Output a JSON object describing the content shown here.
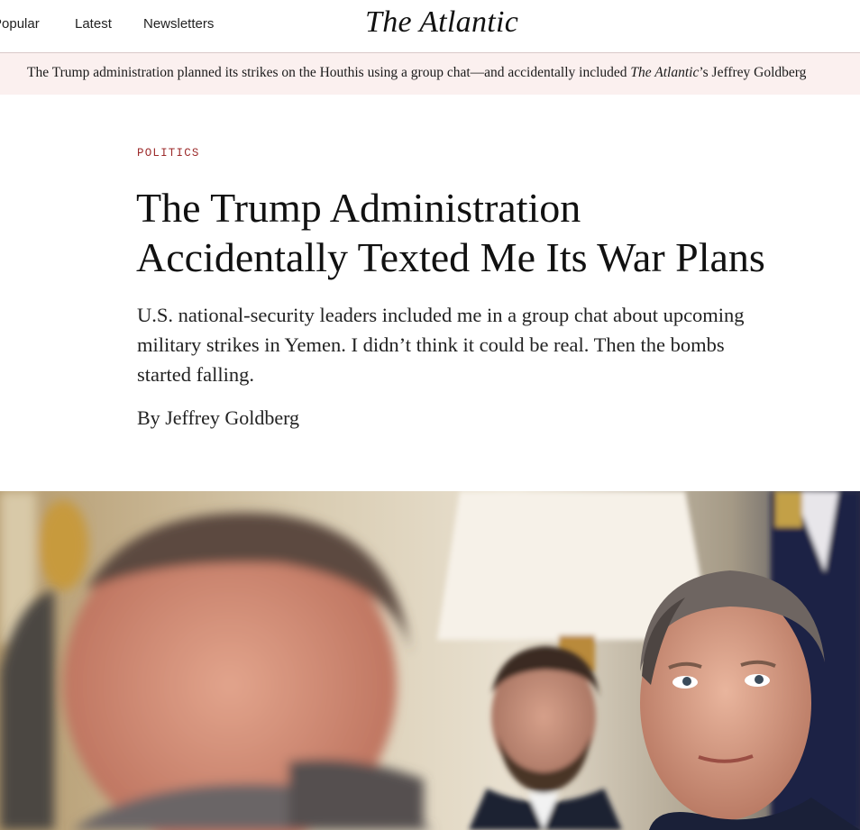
{
  "nav": {
    "items": [
      {
        "label": "Popular"
      },
      {
        "label": "Latest"
      },
      {
        "label": "Newsletters"
      }
    ],
    "logo": "The Atlantic"
  },
  "ticker": {
    "text_before": "The Trump administration planned its strikes on the Houthis using a group chat—and accidentally included ",
    "publication": "The Atlantic",
    "text_after": "’s Jeffrey Goldberg"
  },
  "article": {
    "section": "POLITICS",
    "headline_line1": "The Trump Administration",
    "headline_line2": "Accidentally Texted Me Its War Plans",
    "dek": "U.S. national-security leaders included me in a group chat about upcoming military strikes in Yemen. I didn’t think it could be real. Then the bombs started falling.",
    "byline_prefix": "By ",
    "author": "Jeffrey Goldberg"
  },
  "colors": {
    "section": "#9c2b2b",
    "ticker_bg": "#fbf0ef",
    "rule": "#d9c9c9"
  }
}
